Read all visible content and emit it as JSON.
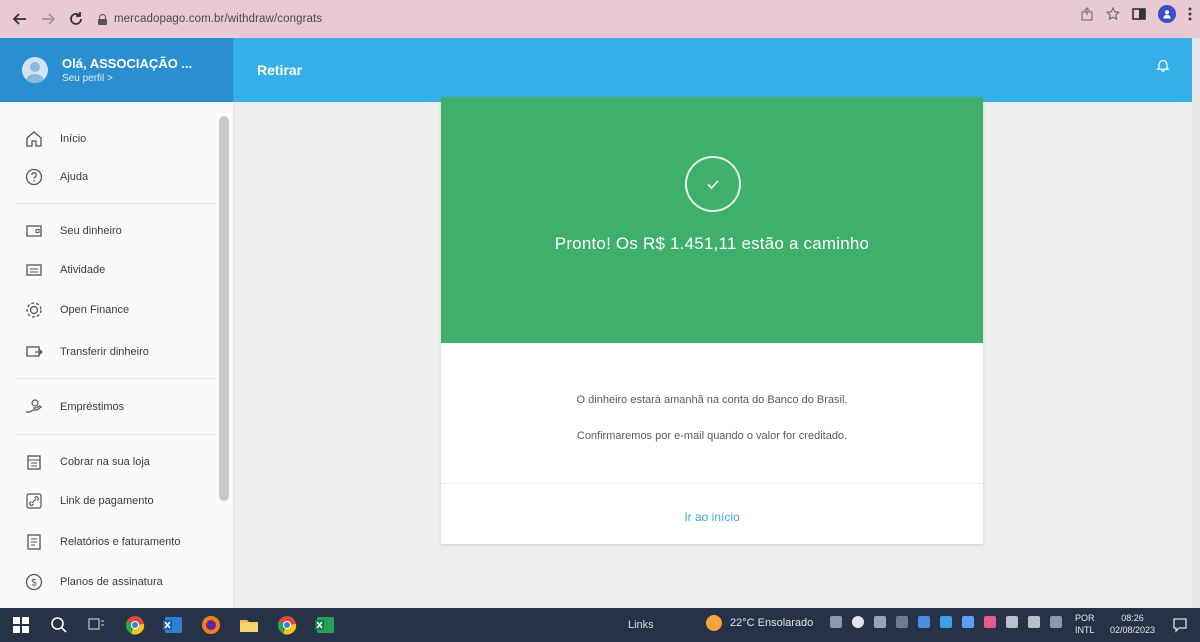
{
  "browser": {
    "url": "mercadopago.com.br/withdraw/congrats"
  },
  "header": {
    "user_name": "Olá, ASSOCIAÇÃO ...",
    "profile_link": "Seu perfil  >",
    "title": "Retirar"
  },
  "sidebar": {
    "items": [
      {
        "label": "Início",
        "icon": "home-icon"
      },
      {
        "label": "Ajuda",
        "icon": "help-icon"
      },
      {
        "label": "Seu dinheiro",
        "icon": "wallet-icon"
      },
      {
        "label": "Atividade",
        "icon": "activity-icon"
      },
      {
        "label": "Open Finance",
        "icon": "open-finance-icon"
      },
      {
        "label": "Transferir dinheiro",
        "icon": "transfer-icon"
      },
      {
        "label": "Empréstimos",
        "icon": "loans-icon"
      },
      {
        "label": "Cobrar na sua loja",
        "icon": "store-icon"
      },
      {
        "label": "Link de pagamento",
        "icon": "link-icon"
      },
      {
        "label": "Relatórios e faturamento",
        "icon": "reports-icon"
      },
      {
        "label": "Planos de assinatura",
        "icon": "subscription-icon"
      }
    ]
  },
  "main": {
    "headline": "Pronto! Os R$ 1.451,11 estão a caminho",
    "info_line_1": "O dinheiro estará amanhã na conta do Banco do Brasil.",
    "info_line_2": "Confirmaremos por e-mail quando o valor for creditado.",
    "go_home_label": "Ir ao início"
  },
  "taskbar": {
    "links_label": "Links",
    "weather": "22°C  Ensolarado",
    "lang_top": "POR",
    "lang_bottom": "INTL",
    "time": "08:26",
    "date": "02/08/2023"
  },
  "colors": {
    "header_blue": "#36aee8",
    "success_green": "#3fb06b",
    "link_blue": "#3fa3e0"
  }
}
